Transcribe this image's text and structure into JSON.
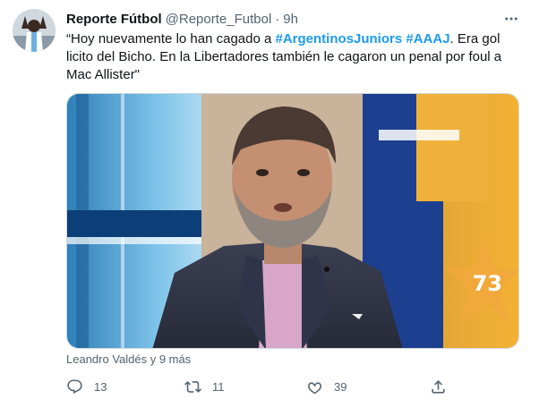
{
  "tweet": {
    "display_name": "Reporte Fútbol",
    "handle": "@Reporte_Futbol",
    "separator": "·",
    "time": "9h",
    "text_before": "“Hoy nuevamente lo han cagado a ",
    "hashtag_1": "#ArgentinosJuniors",
    "text_space": " ",
    "hashtag_2": "#AAAJ",
    "text_after": ". Era gol licito del Bicho. En la Libertadores también le cagaron un penal por foul a Mac Allister\"",
    "image_number": "73",
    "tagged_people": "Leandro Valdés y 9 más"
  },
  "actions": {
    "replies": "13",
    "retweets": "11",
    "likes": "39"
  },
  "icons": {
    "more": "more-icon",
    "reply": "reply-icon",
    "retweet": "retweet-icon",
    "like": "like-icon",
    "share": "share-icon"
  },
  "colors": {
    "accent": "#1d9bf0",
    "text": "#0f1419",
    "muted": "#536471"
  }
}
